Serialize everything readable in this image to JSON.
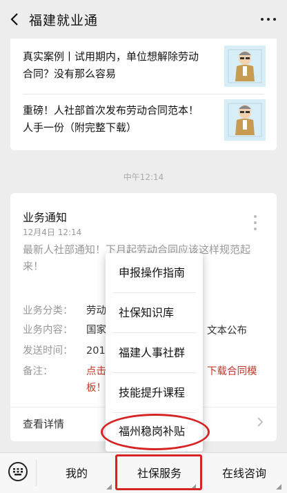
{
  "header": {
    "title": "福建就业通"
  },
  "articles": [
    {
      "line1": "真实案例丨试用期内，单位想解除劳动",
      "line2": "合同？没有那么容易"
    },
    {
      "line1": "重磅！人社部首次发布劳动合同范本！",
      "line2": "人手一份（附完整下载）"
    }
  ],
  "timestamp": "中午12:14",
  "notice": {
    "title": "业务通知",
    "date": "12月4日  12:14",
    "desc_line1": "最新人社部通知！下月起劳动合同应该这样规范起",
    "desc_line2": "来！",
    "rows": [
      {
        "key": "业务分类：",
        "value": "劳动"
      },
      {
        "key": "业务内容：",
        "value": "国家"
      },
      {
        "key": "发送时间：",
        "value": "201"
      },
      {
        "key": "备注：",
        "value": "点击"
      }
    ],
    "content_tail": "文本公布",
    "remark_tail1": "下载合同模",
    "remark_line2": "板！",
    "detail_label": "查看详情"
  },
  "popup_menu": {
    "items": [
      "申报操作指南",
      "社保知识库",
      "福建人事社群",
      "技能提升课程",
      "福州稳岗补贴"
    ]
  },
  "bottom_bar": {
    "tabs": [
      "我的",
      "社保服务",
      "在线咨询"
    ]
  },
  "colors": {
    "highlight": "#d62424",
    "remark": "#c0392b"
  }
}
